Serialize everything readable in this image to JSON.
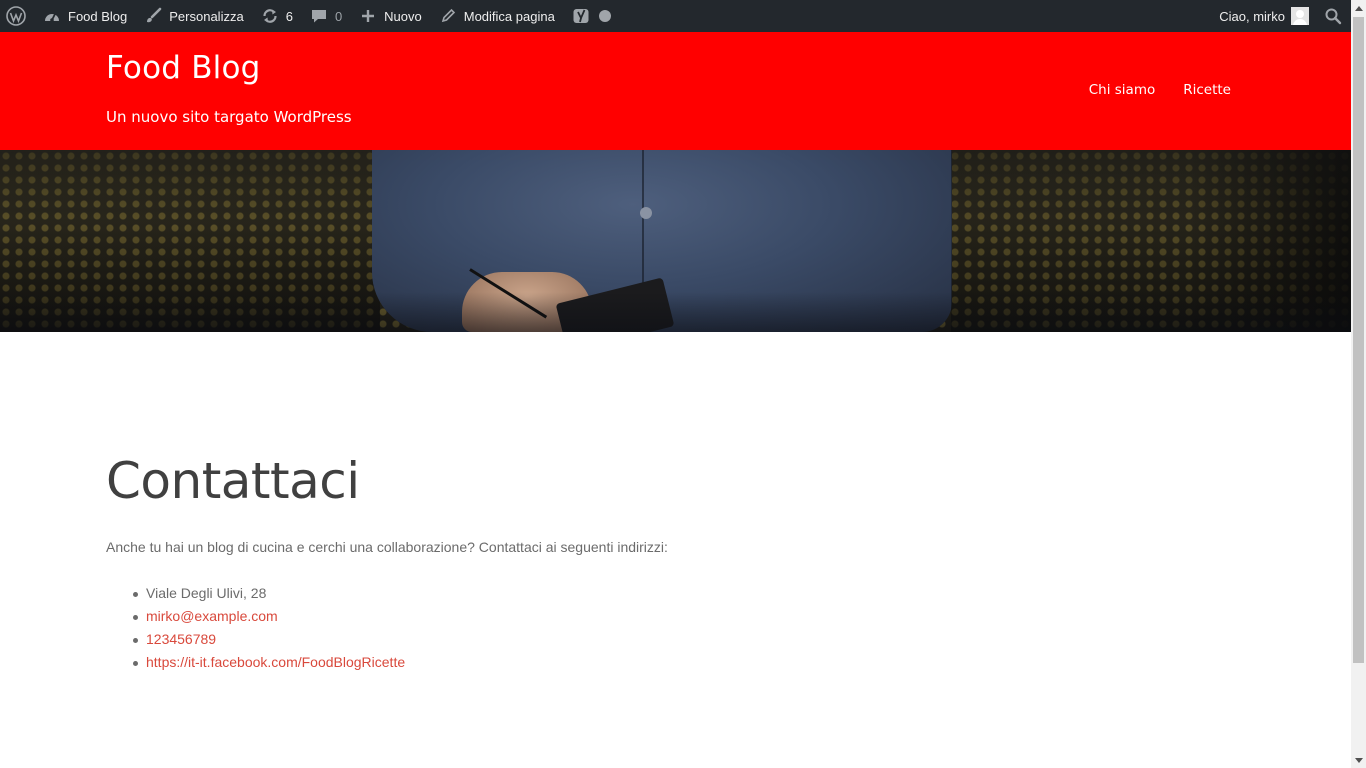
{
  "admin_bar": {
    "site_name": "Food Blog",
    "customize_label": "Personalizza",
    "updates_count": "6",
    "comments_count": "0",
    "new_label": "Nuovo",
    "edit_page_label": "Modifica pagina",
    "greeting": "Ciao, mirko"
  },
  "header": {
    "site_title": "Food Blog",
    "tagline": "Un nuovo sito targato WordPress",
    "nav": [
      "Chi siamo",
      "Ricette"
    ],
    "background_color": "#ff0000"
  },
  "content": {
    "title": "Contattaci",
    "intro": "Anche tu hai un blog di cucina e cerchi una collaborazione? Contattaci ai seguenti indirizzi:",
    "contacts": [
      {
        "text": "Viale Degli Ulivi, 28",
        "link": false
      },
      {
        "text": "mirko@example.com",
        "link": true
      },
      {
        "text": "123456789",
        "link": true
      },
      {
        "text": "https://it-it.facebook.com/FoodBlogRicette",
        "link": true
      }
    ],
    "link_color": "#d9493c"
  },
  "icons": {
    "wordpress": "wordpress-logo-icon",
    "dashboard": "dashboard-icon",
    "brush": "brush-icon",
    "updates": "updates-icon",
    "comment": "comment-icon",
    "plus": "plus-icon",
    "pencil": "pencil-icon",
    "yoast": "yoast-icon",
    "status": "status-dot-icon",
    "search": "search-icon"
  }
}
